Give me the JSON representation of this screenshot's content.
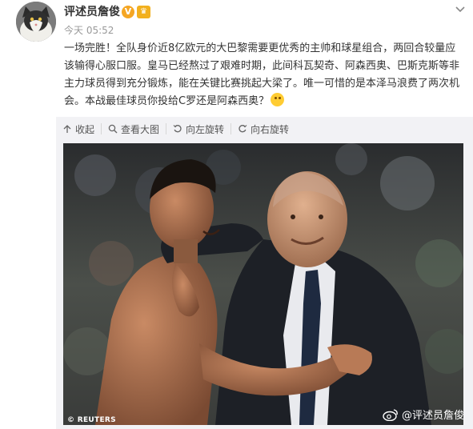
{
  "post": {
    "username": "评述员詹俊",
    "verified_badge": "V",
    "level_badge": "♛",
    "timestamp": "今天 05:52",
    "text": "一场完胜！全队身价近8亿欧元的大巴黎需要更优秀的主帅和球星组合，两回合较量应该输得心服口服。皇马已经熬过了艰难时期，此间科瓦契奇、阿森西奥、巴斯克斯等非主力球员得到充分锻炼，能在关键比赛挑起大梁了。唯一可惜的是本泽马浪费了两次机会。本战最佳球员你投给C罗还是阿森西奥？",
    "emoji": "grin-emoji"
  },
  "toolbar": {
    "collapse": "收起",
    "view_large": "查看大图",
    "rotate_left": "向左旋转",
    "rotate_right": "向右旋转"
  },
  "photo": {
    "credit": "© REUTERS",
    "watermark": "@评述员詹俊"
  },
  "icons": {
    "collapse": "arrow-up-icon",
    "view_large": "magnifier-icon",
    "rotate_left": "rotate-left-icon",
    "rotate_right": "rotate-right-icon",
    "more": "chevron-down-icon",
    "watermark_logo": "weibo-logo-icon"
  },
  "colors": {
    "text": "#333333",
    "muted": "#999999",
    "badge_orange": "#f5a623",
    "media_bg": "#f2f2f5"
  }
}
